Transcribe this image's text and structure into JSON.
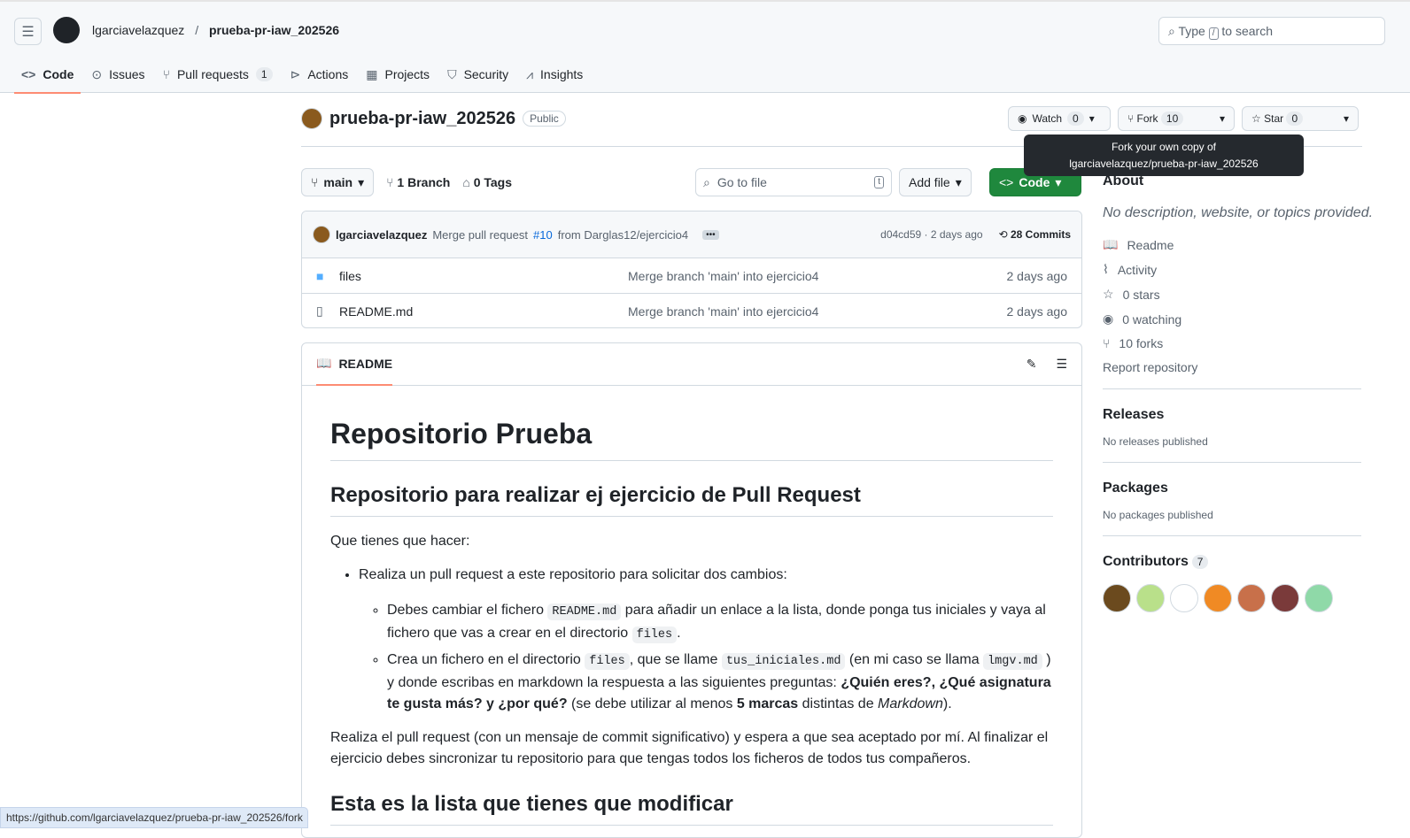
{
  "header": {
    "owner": "lgarciavelazquez",
    "separator": "/",
    "repo": "prueba-pr-iaw_202526",
    "search_prefix": "Type",
    "search_key": "/",
    "search_suffix": "to search"
  },
  "tabs": [
    {
      "label": "Code",
      "icon": "code-icon"
    },
    {
      "label": "Issues",
      "icon": "issue-icon"
    },
    {
      "label": "Pull requests",
      "count": "1",
      "icon": "pr-icon"
    },
    {
      "label": "Actions",
      "icon": "play-icon"
    },
    {
      "label": "Projects",
      "icon": "table-icon"
    },
    {
      "label": "Security",
      "icon": "shield-icon"
    },
    {
      "label": "Insights",
      "icon": "graph-icon"
    }
  ],
  "repo": {
    "name": "prueba-pr-iaw_202526",
    "visibility": "Public",
    "watch": "Watch",
    "watch_count": "0",
    "fork": "Fork",
    "fork_count": "10",
    "star": "Star",
    "star_count": "0"
  },
  "tooltip": {
    "line1": "Fork your own copy of",
    "line2": "lgarciavelazquez/prueba-pr-iaw_202526"
  },
  "toolbar": {
    "branch": "main",
    "branches": "1 Branch",
    "tags": "0 Tags",
    "goto": "Go to file",
    "goto_key": "t",
    "add_file": "Add file",
    "code": "Code"
  },
  "commit": {
    "author": "lgarciavelazquez",
    "msg_pre": "Merge pull request",
    "pr": "#10",
    "msg_post": "from Darglas12/ejercicio4",
    "sha_time": "d04cd59 · 2 days ago",
    "commits": "28 Commits"
  },
  "files": [
    {
      "name": "files",
      "type": "folder",
      "msg": "Merge branch 'main' into ejercicio4",
      "time": "2 days ago"
    },
    {
      "name": "README.md",
      "type": "file",
      "msg": "Merge branch 'main' into ejercicio4",
      "time": "2 days ago"
    }
  ],
  "readme": {
    "tab": "README",
    "h1": "Repositorio Prueba",
    "h2": "Repositorio para realizar ej ejercicio de Pull Request",
    "p1": "Que tienes que hacer:",
    "li1": "Realiza un pull request a este repositorio para solicitar dos cambios:",
    "s1a": "Debes cambiar el fichero",
    "c1": "README.md",
    "s1b": "para añadir un enlace a la lista, donde ponga tus iniciales y vaya al fichero que vas a crear en el directorio",
    "c2": "files",
    "s1c": ".",
    "s2a": "Crea un fichero en el directorio",
    "c3": "files",
    "s2b": ", que se llame",
    "c4": "tus_iniciales.md",
    "s2c": "(en mi caso se llama",
    "c5": "lmgv.md",
    "s2d": ") y donde escribas en markdown la respuesta a las siguientes preguntas:",
    "b1": "¿Quién eres?, ¿Qué asignatura te gusta más? y ¿por qué?",
    "s2e": "(se debe utilizar al menos",
    "b2": "5 marcas",
    "s2f": "distintas de",
    "i1": "Markdown",
    "s2g": ").",
    "p2": "Realiza el pull request (con un mensaje de commit significativo) y espera a que sea aceptado por mí. Al finalizar el ejercicio debes sincronizar tu repositorio para que tengas todos los ficheros de todos tus compañeros.",
    "h2b": "Esta es la lista que tienes que modificar"
  },
  "about": {
    "title": "About",
    "desc": "No description, website, or topics provided.",
    "items": [
      {
        "label": "Readme",
        "icon": "book-icon"
      },
      {
        "label": "Activity",
        "icon": "pulse-icon"
      },
      {
        "label": "0 stars",
        "icon": "star-icon"
      },
      {
        "label": "0 watching",
        "icon": "eye-icon"
      },
      {
        "label": "10 forks",
        "icon": "fork-icon"
      }
    ],
    "report": "Report repository"
  },
  "releases": {
    "title": "Releases",
    "text": "No releases published"
  },
  "packages": {
    "title": "Packages",
    "text": "No packages published"
  },
  "contributors": {
    "title": "Contributors",
    "count": "7",
    "colors": [
      "#6b4a1e",
      "#b9e08a",
      "#ffffff",
      "#f08a24",
      "#c8704a",
      "#7a3a3a",
      "#8fd9a8"
    ]
  },
  "status_url": "https://github.com/lgarciavelazquez/prueba-pr-iaw_202526/fork"
}
